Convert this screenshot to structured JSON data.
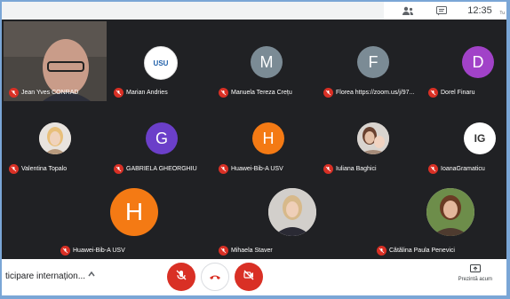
{
  "topbar": {
    "time": "12:35",
    "corner_text": "Tu"
  },
  "participants": [
    {
      "name": "Jean Yves CONRAD",
      "kind": "video"
    },
    {
      "name": "Marian Andries",
      "kind": "logo",
      "avatar_text": "USU",
      "color": "#1f5fa9"
    },
    {
      "name": "Manuela Tereza Crețu",
      "kind": "letter",
      "avatar_text": "M",
      "color": "#7b8b95"
    },
    {
      "name": "Florea https://zoom.us/j/97...",
      "kind": "letter",
      "avatar_text": "F",
      "color": "#7b8b95"
    },
    {
      "name": "Dorel Finaru",
      "kind": "letter",
      "avatar_text": "D",
      "color": "#a142c8"
    },
    {
      "name": "Valentina Topalo",
      "kind": "photo"
    },
    {
      "name": "GABRIELA GHEORGHIU",
      "kind": "letter",
      "avatar_text": "G",
      "color": "#6b3fc9"
    },
    {
      "name": "Huawei-Bib-A USV",
      "kind": "letter",
      "avatar_text": "H",
      "color": "#f47a14"
    },
    {
      "name": "Iuliana Baghici",
      "kind": "photo"
    },
    {
      "name": "IoanaGramaticu",
      "kind": "logo",
      "avatar_text": "IG",
      "color": "#ffffff"
    },
    {
      "name": "Huawei-Bib-A USV",
      "kind": "letter",
      "avatar_text": "H",
      "color": "#f47a14"
    },
    {
      "name": "Mihaela Staver",
      "kind": "photo"
    },
    {
      "name": "Cătălina Paula Penevici",
      "kind": "photo"
    }
  ],
  "bottombar": {
    "meeting_title": "ticipare internațion...",
    "present_label": "Prezintă acum",
    "colors": {
      "end_call": "#d93025"
    }
  }
}
